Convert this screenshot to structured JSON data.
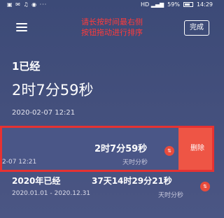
{
  "status_bar": {
    "left_icons": "▣ ✉ ♫ ◉ ···",
    "signal_text": "HD ▂▄▆",
    "battery": "59%",
    "time": "14:29"
  },
  "header": {
    "hint_line1": "请长按时间最右侧",
    "hint_line2": "按钮拖动进行排序",
    "done_label": "完成"
  },
  "card1": {
    "label": "1已经",
    "value": "2时7分59秒",
    "date": "2020-02-07 12:21"
  },
  "selected_row": {
    "date_partial": "2-07 12:21",
    "value": "2时7分59秒",
    "unit": "天时分秒",
    "sort_icon": "⇅",
    "delete_label": "删除"
  },
  "row2": {
    "label": "2020年已经",
    "value": "37天14时29分21秒",
    "date_range": "2020.01.01 - 2020.12.31",
    "unit": "天时分秒",
    "sort_icon": "⇅"
  },
  "colors": {
    "hint": "#ff3b3b",
    "delete": "#ee5545",
    "highlight_border": "#e63232"
  }
}
